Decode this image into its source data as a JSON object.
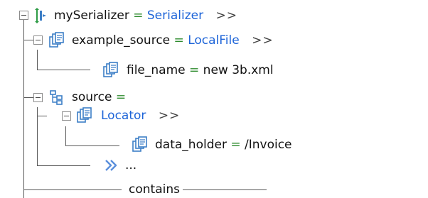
{
  "colors": {
    "name": "#111111",
    "equals": "#2e8b2e",
    "type_value": "#1d64d8",
    "tree_lines": "#5a5a5a",
    "icon_blue": "#3c7ec6",
    "icon_green": "#2e9b45"
  },
  "tree": {
    "root": {
      "name": "mySerializer",
      "equals": "=",
      "value": "Serializer",
      "more": ">>",
      "icon": "serializer-icon"
    },
    "example_source": {
      "name": "example_source",
      "equals": "=",
      "value": "LocalFile",
      "more": ">>",
      "icon": "object-icon"
    },
    "file_name": {
      "name": "file_name",
      "equals": "=",
      "value": "new 3b.xml",
      "icon": "object-icon"
    },
    "source": {
      "name": "source",
      "equals": "=",
      "icon": "hierarchy-icon"
    },
    "locator": {
      "name": "Locator",
      "more": ">>",
      "icon": "object-icon"
    },
    "data_holder": {
      "name": "data_holder",
      "equals": "=",
      "value": "/Invoice",
      "icon": "object-icon"
    },
    "more_item": {
      "text": "...",
      "icon": "double-chevron-icon"
    },
    "contains": {
      "label": "contains"
    }
  }
}
